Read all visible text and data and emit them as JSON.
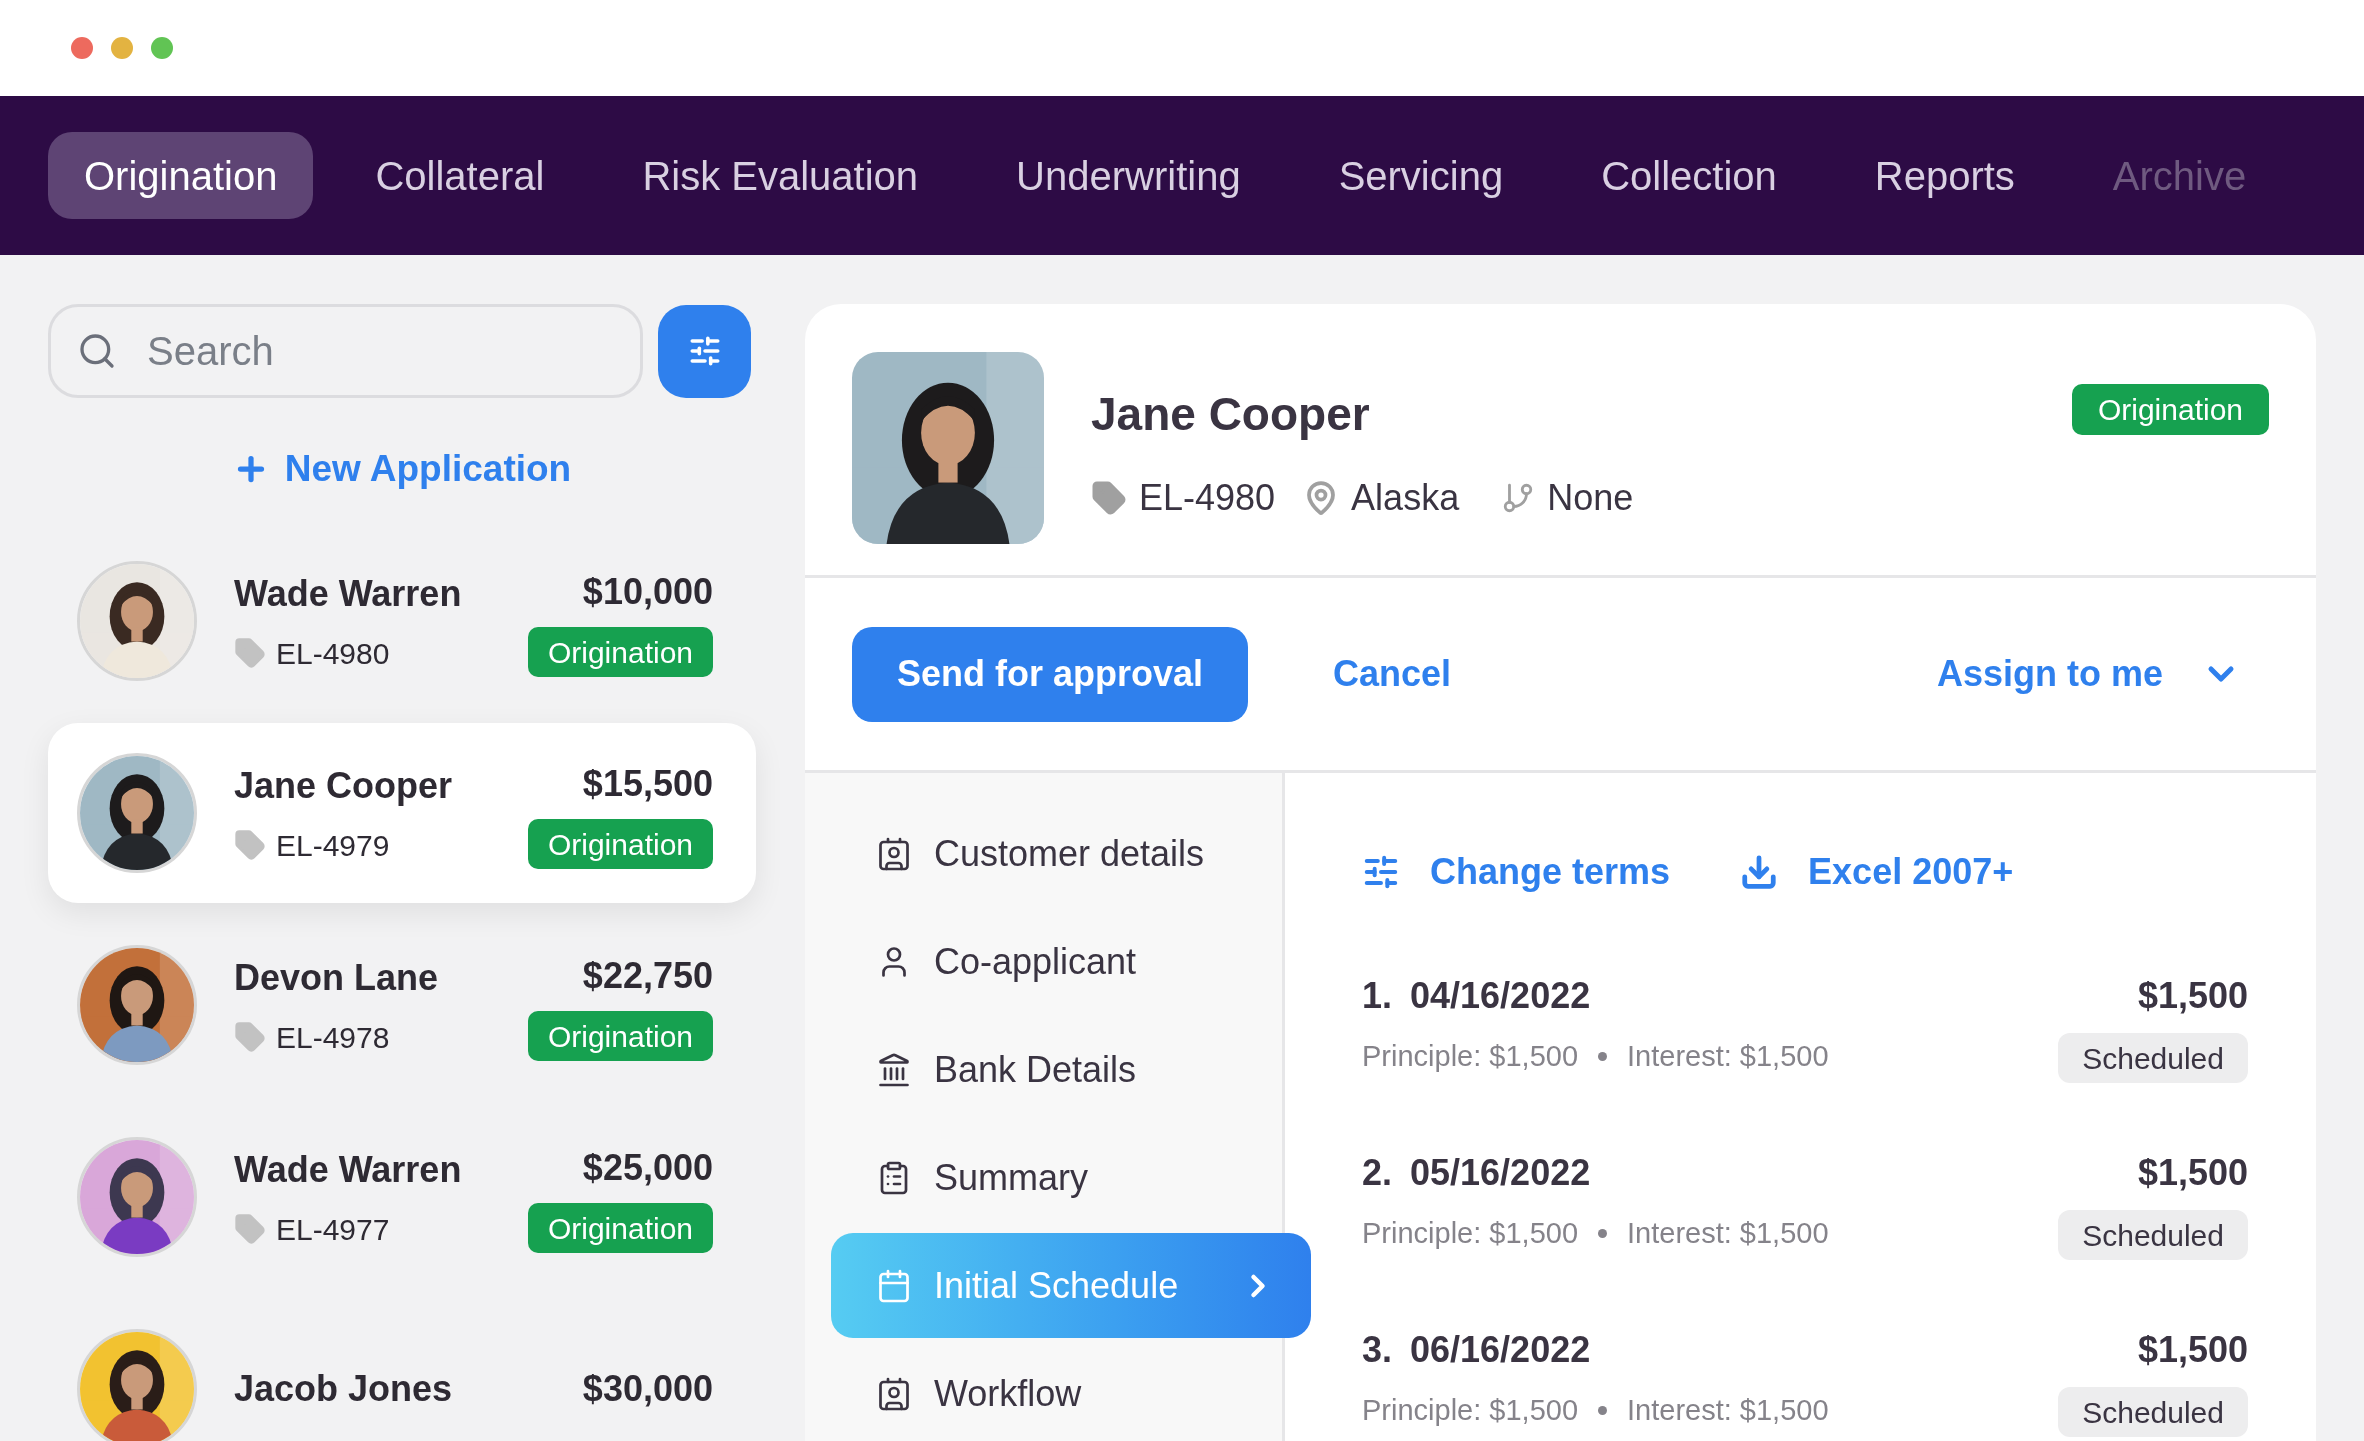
{
  "window_controls": [
    {
      "color": "#ed6a5e"
    },
    {
      "color": "#e3b341"
    },
    {
      "color": "#61c454"
    }
  ],
  "nav_tabs": [
    {
      "label": "Origination",
      "selected": true,
      "disabled": false
    },
    {
      "label": "Collateral",
      "selected": false,
      "disabled": false
    },
    {
      "label": "Risk Evaluation",
      "selected": false,
      "disabled": false
    },
    {
      "label": "Underwriting",
      "selected": false,
      "disabled": false
    },
    {
      "label": "Servicing",
      "selected": false,
      "disabled": false
    },
    {
      "label": "Collection",
      "selected": false,
      "disabled": false
    },
    {
      "label": "Reports",
      "selected": false,
      "disabled": false
    },
    {
      "label": "Archive",
      "selected": false,
      "disabled": true
    }
  ],
  "search": {
    "placeholder": "Search"
  },
  "new_application": "New Application",
  "applications": [
    {
      "name": "Wade Warren",
      "id": "EL-4980",
      "amount": "$10,000",
      "status": "Origination",
      "selected": false
    },
    {
      "name": "Jane Cooper",
      "id": "EL-4979",
      "amount": "$15,500",
      "status": "Origination",
      "selected": true
    },
    {
      "name": "Devon Lane",
      "id": "EL-4978",
      "amount": "$22,750",
      "status": "Origination",
      "selected": false
    },
    {
      "name": "Wade Warren",
      "id": "EL-4977",
      "amount": "$25,000",
      "status": "Origination",
      "selected": false
    },
    {
      "name": "Jacob Jones",
      "amount": "$30,000",
      "selected": false
    }
  ],
  "detail": {
    "name": "Jane Cooper",
    "status": "Origination",
    "id": "EL-4980",
    "location": "Alaska",
    "branch": "None"
  },
  "actions": {
    "primary": "Send for approval",
    "cancel": "Cancel",
    "assign": "Assign to me"
  },
  "sections": [
    {
      "label": "Customer details",
      "selected": false
    },
    {
      "label": "Co-applicant",
      "selected": false
    },
    {
      "label": "Bank Details",
      "selected": false
    },
    {
      "label": "Summary",
      "selected": false
    },
    {
      "label": "Initial Schedule",
      "selected": true
    },
    {
      "label": "Workflow",
      "selected": false
    }
  ],
  "toolbar": [
    "Change terms",
    "Excel 2007+"
  ],
  "schedule": [
    {
      "number": "1.",
      "date": "04/16/2022",
      "principal": "Principle: $1,500",
      "interest": "Interest: $1,500",
      "amount": "$1,500",
      "status": "Scheduled"
    },
    {
      "number": "2.",
      "date": "05/16/2022",
      "principal": "Principle: $1,500",
      "interest": "Interest: $1,500",
      "amount": "$1,500",
      "status": "Scheduled"
    },
    {
      "number": "3.",
      "date": "06/16/2022",
      "principal": "Principle: $1,500",
      "interest": "Interest: $1,500",
      "amount": "$1,500",
      "status": "Scheduled"
    }
  ]
}
